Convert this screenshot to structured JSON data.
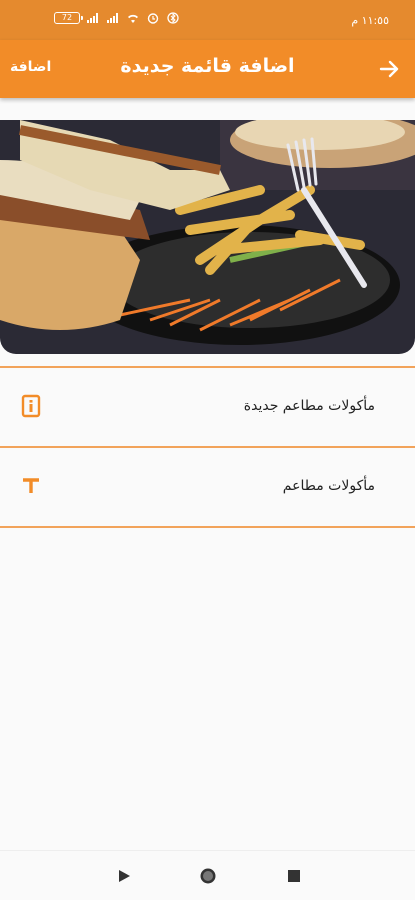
{
  "status_bar": {
    "time": "١١:٥٥ م",
    "battery": "72",
    "icons": [
      "battery-icon",
      "signal-icon",
      "signal-icon",
      "wifi-icon",
      "alarm-icon",
      "bluetooth-icon"
    ]
  },
  "app_bar": {
    "title": "اضافة قائمة جديدة",
    "add_label": "اضافة",
    "back_icon": "arrow-right-icon"
  },
  "hero": {
    "image": "food-plate-photo"
  },
  "list": {
    "items": [
      {
        "label": "مأكولات مطاعم جديدة",
        "icon": "info-box-icon"
      },
      {
        "label": "مأكولات مطاعم",
        "icon": "text-t-icon"
      }
    ]
  },
  "navigation": {
    "buttons": [
      "back-triangle-icon",
      "home-circle-icon",
      "recents-square-icon"
    ]
  },
  "colors": {
    "primary": "#f28c28",
    "status_bar": "#e58a2e",
    "divider": "#f2a35a",
    "background": "#fafafa"
  }
}
